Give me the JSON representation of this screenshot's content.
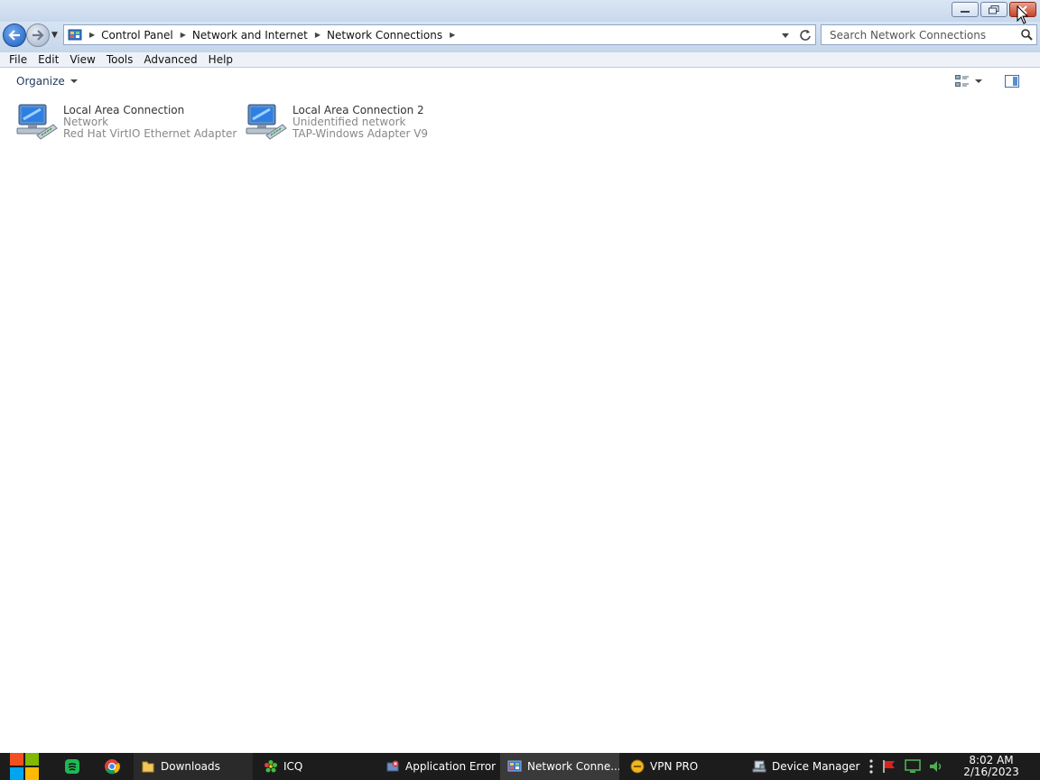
{
  "window": {
    "controls": {
      "minimize": "minimize-icon",
      "restore": "restore-icon",
      "close": "close-icon"
    }
  },
  "address": {
    "crumbs": [
      "Control Panel",
      "Network and Internet",
      "Network Connections"
    ],
    "search_placeholder": "Search Network Connections"
  },
  "menu": [
    "File",
    "Edit",
    "View",
    "Tools",
    "Advanced",
    "Help"
  ],
  "commandbar": {
    "organize": "Organize"
  },
  "connections": [
    {
      "name": "Local Area Connection",
      "status": "Network",
      "adapter": "Red Hat VirtIO Ethernet Adapter"
    },
    {
      "name": "Local Area Connection 2",
      "status": "Unidentified network",
      "adapter": "TAP-Windows Adapter V9"
    }
  ],
  "taskbar": {
    "tasks": [
      {
        "label": "Downloads"
      },
      {
        "label": "ICQ"
      },
      {
        "label": "Application Error"
      },
      {
        "label": "Network Conne..."
      },
      {
        "label": "VPN PRO"
      },
      {
        "label": "Device Manager"
      }
    ],
    "clock": {
      "time": "8:02 AM",
      "date": "2/16/2023"
    }
  },
  "colors": {
    "accent": "#1f5fbf",
    "close": "#c7432b",
    "taskbar": "#1c1c1c"
  }
}
